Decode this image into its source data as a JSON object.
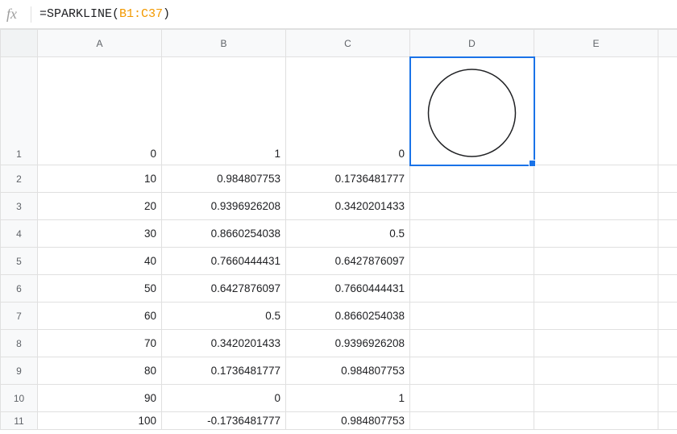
{
  "formula": {
    "equals": "=",
    "fn_open": "SPARKLINE(",
    "range": "B1:C37",
    "fn_close": ")"
  },
  "columns": [
    "A",
    "B",
    "C",
    "D",
    "E"
  ],
  "row_headers": [
    "1",
    "2",
    "3",
    "4",
    "5",
    "6",
    "7",
    "8",
    "9",
    "10",
    "11"
  ],
  "rows": [
    {
      "a": "0",
      "b": "1",
      "c": "0"
    },
    {
      "a": "10",
      "b": "0.984807753",
      "c": "0.1736481777"
    },
    {
      "a": "20",
      "b": "0.9396926208",
      "c": "0.3420201433"
    },
    {
      "a": "30",
      "b": "0.8660254038",
      "c": "0.5"
    },
    {
      "a": "40",
      "b": "0.7660444431",
      "c": "0.6427876097"
    },
    {
      "a": "50",
      "b": "0.6427876097",
      "c": "0.7660444431"
    },
    {
      "a": "60",
      "b": "0.5",
      "c": "0.8660254038"
    },
    {
      "a": "70",
      "b": "0.3420201433",
      "c": "0.9396926208"
    },
    {
      "a": "80",
      "b": "0.1736481777",
      "c": "0.984807753"
    },
    {
      "a": "90",
      "b": "0",
      "c": "1"
    },
    {
      "a": "100",
      "b": "-0.1736481777",
      "c": "0.984807753"
    }
  ]
}
